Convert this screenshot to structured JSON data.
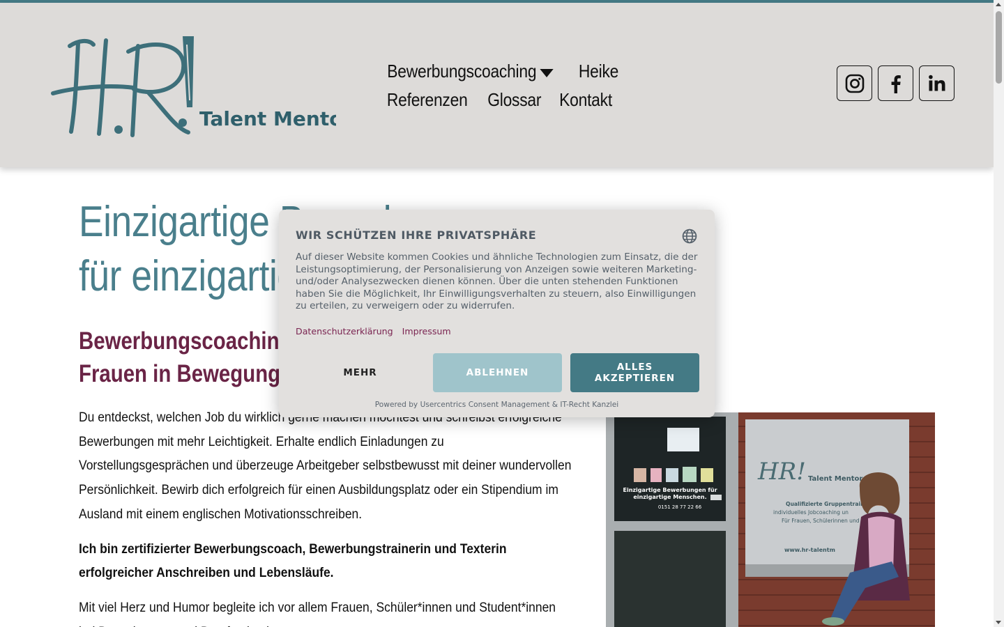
{
  "colors": {
    "accent": "#447a85",
    "header_bg": "#dddbd9",
    "hero_title": "#4a7f8c",
    "subtitle": "#6a2446",
    "consent_link": "#7a2451",
    "deny_button": "#9fc4cb"
  },
  "logo": {
    "mark": "HR!",
    "wordmark": "Talent Mentor"
  },
  "nav": {
    "items": [
      {
        "label": "Bewerbungscoaching",
        "has_dropdown": true
      },
      {
        "label": "Heike"
      },
      {
        "label": "Referenzen"
      },
      {
        "label": "Glossar"
      },
      {
        "label": "Kontakt"
      }
    ]
  },
  "social": [
    {
      "icon": "instagram-icon"
    },
    {
      "icon": "facebook-icon"
    },
    {
      "icon": "linkedin-icon"
    }
  ],
  "main": {
    "hero_line1": "Einzigartige Bewerbungen",
    "hero_line2": "für einzigartige Menschen.",
    "subtitle_line1": "Bewerbungscoaching & Jobcoaching für",
    "subtitle_line2": "Frauen in Bewegung",
    "paragraph1": "Du entdeckst, welchen Job du wirklich gerne machen möchtest und schreibst erfolgreiche Bewerbungen mit mehr Leichtigkeit. Erhalte endlich Einladungen zu Vorstellungsgesprächen und überzeuge Arbeitgeber selbstbewusst mit deiner wundervollen Persönlichkeit. Bewirb dich erfolgreich für einen Ausbildungsplatz oder ein Stipendium im Ausland mit einem englischen Motivationsschreiben.",
    "paragraph2": "Ich bin zertifizierter Bewerbungscoach, Bewerbungstrainerin und Texterin erfolgreicher Anschreiben und Lebensläufe.",
    "paragraph3": "Mit viel Herz und Humor begleite ich vor allem Frauen, Schüler*innen und Student*innen bei Bewerbungen und Berufsorientierung."
  },
  "photo": {
    "door_sign_line1": "Einzigartige Bewerbungen für",
    "door_sign_line2": "einzigartige Menschen.",
    "door_phone": "0151 28 77 22 66",
    "board_logo": "HR!",
    "board_wordmark": "Talent Mentor",
    "board_line1": "Qualifizierte Gruppentrain",
    "board_line2": "individuelles Jobcoaching un",
    "board_line3": "Für Frauen, Schülerinnen und",
    "board_url": "www.hr-talentm"
  },
  "consent": {
    "title": "WIR SCHÜTZEN IHRE PRIVATSPHÄRE",
    "text": "Auf dieser Website kommen Cookies und ähnliche Technologien zum Einsatz, die der Leistungsoptimierung, der Personalisierung von Anzeigen sowie weiteren Marketing- und/oder Analysezwecken dienen können. Über die unten stehenden Funktionen haben Sie die Möglichkeit, Ihr Einwilligungsverhalten zu steuern, also Einwilligungen zu erteilen, zu verweigern oder zu widerrufen.",
    "link_privacy": "Datenschutzerklärung",
    "link_imprint": "Impressum",
    "btn_more": "MEHR",
    "btn_deny": "ABLEHNEN",
    "btn_accept": "ALLES AKZEPTIEREN",
    "powered_by": "Powered by Usercentrics Consent Management & IT-Recht Kanzlei",
    "language_icon": "globe-icon"
  }
}
